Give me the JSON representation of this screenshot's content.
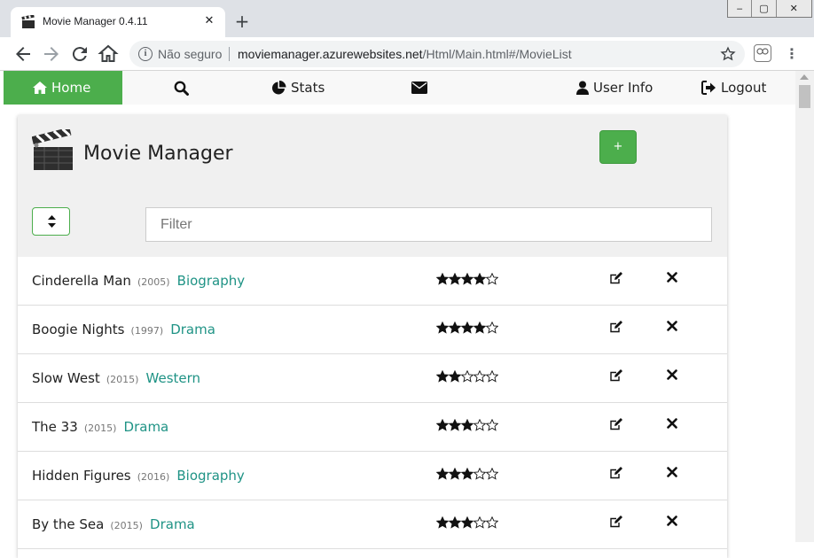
{
  "browser": {
    "tab_title": "Movie Manager 0.4.11",
    "tab_close": "✕",
    "new_tab": "+",
    "security_label": "Não seguro",
    "url_domain": "moviemanager.azurewebsites.net",
    "url_path": "/Html/Main.html#/MovieList",
    "window_controls": [
      "‒",
      "▢",
      "✕"
    ]
  },
  "nav": {
    "home": "Home",
    "stats": "Stats",
    "user_info": "User Info",
    "logout": "Logout"
  },
  "header": {
    "app_title": "Movie Manager",
    "add_label": "+",
    "filter_placeholder": "Filter"
  },
  "colors": {
    "accent_green": "#4cae4c",
    "genre_teal": "#1f9385"
  },
  "movies": [
    {
      "title": "Cinderella Man",
      "year": "(2005)",
      "genre": "Biography",
      "rating": 4
    },
    {
      "title": "Boogie Nights",
      "year": "(1997)",
      "genre": "Drama",
      "rating": 4
    },
    {
      "title": "Slow West",
      "year": "(2015)",
      "genre": "Western",
      "rating": 2
    },
    {
      "title": "The 33",
      "year": "(2015)",
      "genre": "Drama",
      "rating": 3
    },
    {
      "title": "Hidden Figures",
      "year": "(2016)",
      "genre": "Biography",
      "rating": 3
    },
    {
      "title": "By the Sea",
      "year": "(2015)",
      "genre": "Drama",
      "rating": 3
    }
  ],
  "rating_max": 5
}
